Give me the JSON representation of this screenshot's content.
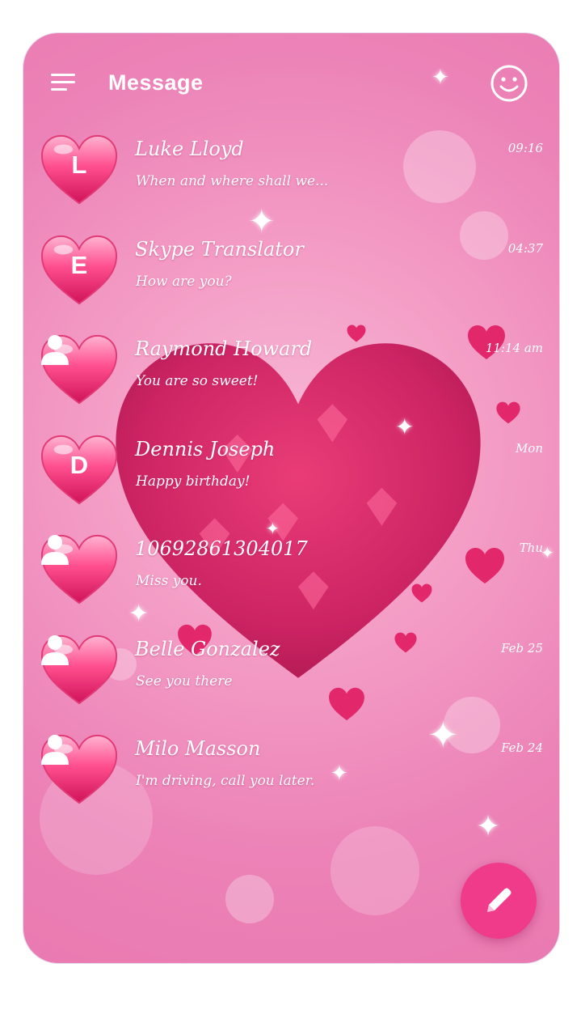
{
  "header": {
    "title": "Message",
    "menu_icon": "hamburger-menu-icon",
    "emoji_icon": "smiley-face-icon"
  },
  "conversations": [
    {
      "avatar_type": "letter",
      "avatar_letter": "L",
      "name": "Luke Lloyd",
      "preview": "When and where shall we...",
      "time": "09:16"
    },
    {
      "avatar_type": "letter",
      "avatar_letter": "E",
      "name": "Skype Translator",
      "preview": "How are you?",
      "time": "04:37"
    },
    {
      "avatar_type": "person",
      "avatar_letter": "",
      "name": "Raymond Howard",
      "preview": "You are so sweet!",
      "time": "11:14 am"
    },
    {
      "avatar_type": "letter",
      "avatar_letter": "D",
      "name": "Dennis Joseph",
      "preview": "Happy birthday!",
      "time": "Mon"
    },
    {
      "avatar_type": "person",
      "avatar_letter": "",
      "name": "10692861304017",
      "preview": "Miss you.",
      "time": "Thu"
    },
    {
      "avatar_type": "person",
      "avatar_letter": "",
      "name": "Belle Gonzalez",
      "preview": "See you there",
      "time": "Feb 25"
    },
    {
      "avatar_type": "person",
      "avatar_letter": "",
      "name": "Milo Masson",
      "preview": "I'm driving, call you later.",
      "time": "Feb 24"
    }
  ],
  "fab": {
    "icon": "pencil-compose-icon"
  },
  "colors": {
    "accent": "#ef3b8a",
    "heart_light": "#ff7fb2",
    "heart_dark": "#d8155e",
    "background": "#f39ac4"
  }
}
